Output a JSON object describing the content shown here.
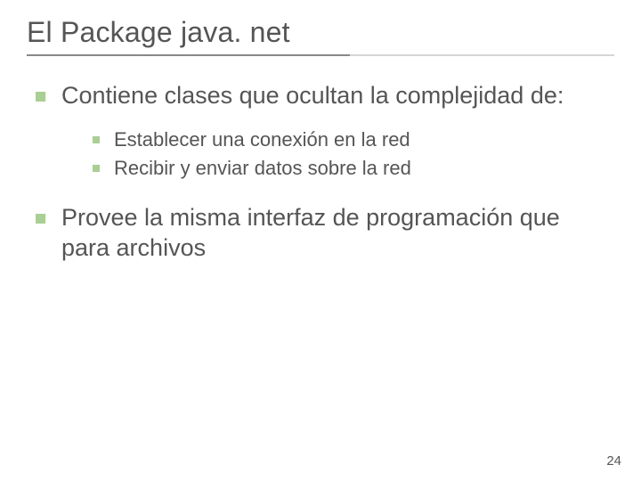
{
  "title": "El Package java. net",
  "items": [
    {
      "text": "Contiene clases que ocultan la complejidad de:",
      "sub": [
        "Establecer una conexión en la red",
        "Recibir y enviar datos sobre la red"
      ]
    },
    {
      "text": "Provee la misma interfaz de programación que para archivos",
      "sub": []
    }
  ],
  "page_number": "24",
  "bullet_color": "#a9cf95"
}
